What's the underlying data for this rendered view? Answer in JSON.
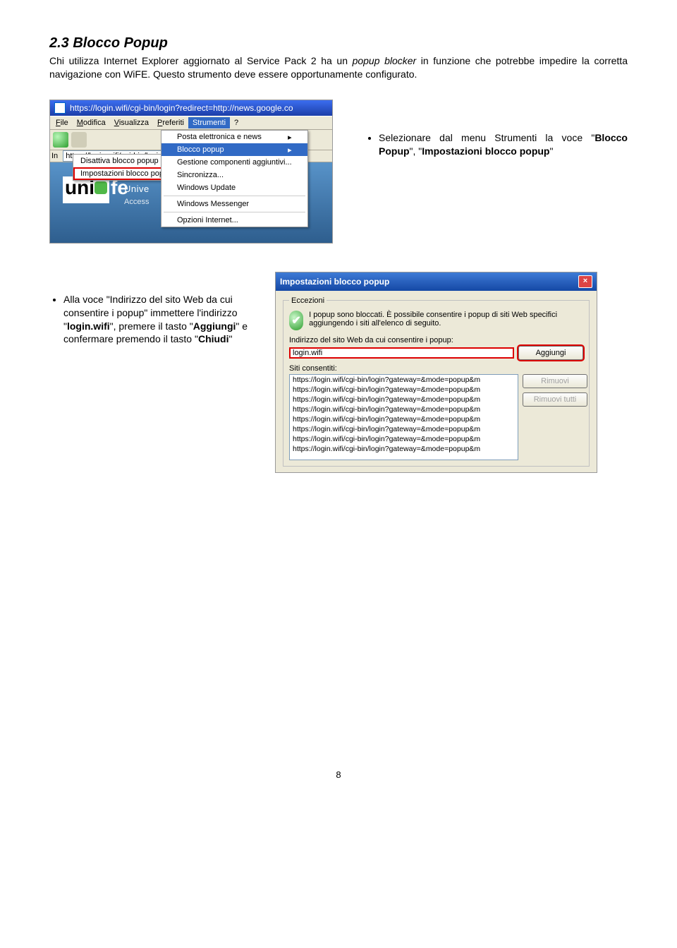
{
  "section": {
    "title": "2.3 Blocco Popup",
    "intro": "Chi utilizza Internet Explorer aggiornato al Service Pack 2 ha un popup blocker in funzione che potrebbe impedire la corretta navigazione con WiFE. Questo strumento deve essere opportunamente configurato."
  },
  "shot1": {
    "windowTitle": "https://login.wifi/cgi-bin/login?redirect=http://news.google.co",
    "menubar": [
      "File",
      "Modifica",
      "Visualizza",
      "Preferiti",
      "Strumenti",
      "?"
    ],
    "toolsMenu": {
      "items": [
        {
          "label": "Posta elettronica e news",
          "hasSubmenu": true
        },
        {
          "label": "Blocco popup",
          "hasSubmenu": true,
          "selected": true
        },
        {
          "label": "Gestione componenti aggiuntivi..."
        },
        {
          "label": "Sincronizza..."
        },
        {
          "label": "Windows Update"
        },
        {
          "sep": true
        },
        {
          "label": "Windows Messenger"
        },
        {
          "sep": true
        },
        {
          "label": "Opzioni Internet..."
        }
      ]
    },
    "popupSubmenu": {
      "items": [
        {
          "label": "Disattiva blocco popup"
        },
        {
          "label": "Impostazioni blocco popup...",
          "highlighted": true
        }
      ]
    },
    "addressLabel": "In",
    "addressValue": "https://login.wifi/cgi-bin/login?red",
    "site": {
      "word1": "uni",
      "word2": "fe",
      "line1": "Unive",
      "line2": "Access"
    }
  },
  "bullet1": "Selezionare dal menu Strumenti la voce \"Blocco Popup\", \"Impostazioni blocco popup\"",
  "bullet1_rich": {
    "pre": "Selezionare dal menu Strumenti la voce \"",
    "b1": "Blocco Popup",
    "mid": "\", \"",
    "b2": "Impostazioni blocco popup",
    "post": "\""
  },
  "shot2": {
    "dlgTitle": "Impostazioni blocco popup",
    "legend": "Eccezioni",
    "note": "I popup sono bloccati. È possibile consentire i popup di siti Web specifici aggiungendo i siti all'elenco di seguito.",
    "lblAddress": "Indirizzo del sito Web da cui consentire i popup:",
    "inputValue": "login.wifi",
    "btnAdd": "Aggiungi",
    "lblAllowed": "Siti consentiti:",
    "sites": [
      "https://login.wifi/cgi-bin/login?gateway=&mode=popup&m",
      "https://login.wifi/cgi-bin/login?gateway=&mode=popup&m",
      "https://login.wifi/cgi-bin/login?gateway=&mode=popup&m",
      "https://login.wifi/cgi-bin/login?gateway=&mode=popup&m",
      "https://login.wifi/cgi-bin/login?gateway=&mode=popup&m",
      "https://login.wifi/cgi-bin/login?gateway=&mode=popup&m",
      "https://login.wifi/cgi-bin/login?gateway=&mode=popup&m",
      "https://login.wifi/cgi-bin/login?gateway=&mode=popup&m"
    ],
    "btnRemove": "Rimuovi",
    "btnRemoveAll": "Rimuovi tutti"
  },
  "bullet2_rich": {
    "t1": "Alla voce \"Indirizzo del sito Web da cui consentire i popup\" immettere l'indirizzo \"",
    "b1": "login.wifi",
    "t2": "\", premere il tasto \"",
    "b2": "Aggiungi",
    "t3": "\" e confermare premendo il tasto \"",
    "b3": "Chiudi",
    "t4": "\""
  },
  "pagenum": "8"
}
